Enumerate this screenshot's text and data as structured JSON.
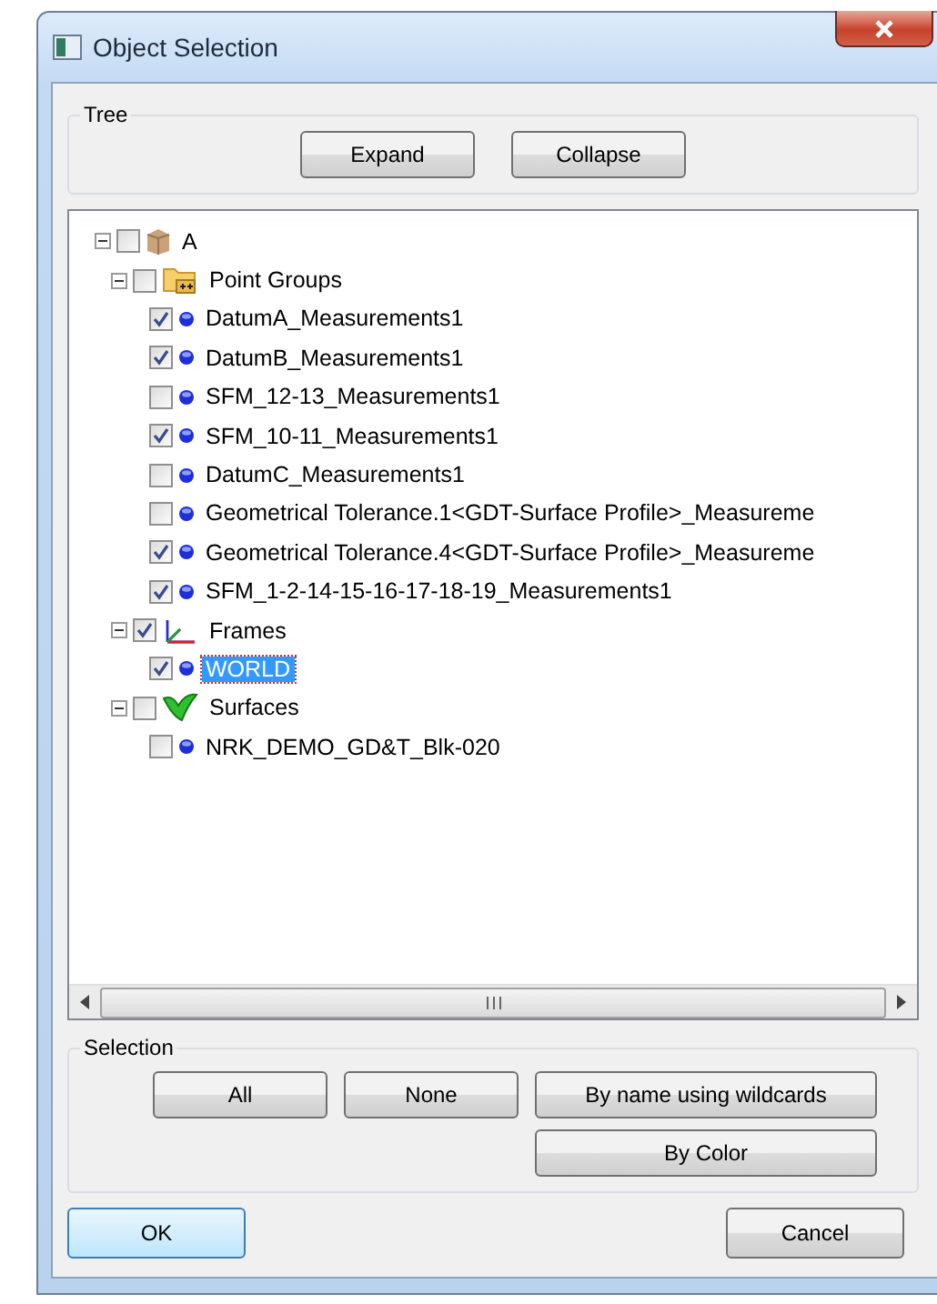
{
  "window": {
    "title": "Object Selection"
  },
  "tree_group": {
    "title": "Tree",
    "buttons": [
      "Expand",
      "Collapse"
    ]
  },
  "tree": [
    {
      "label": "A",
      "kind": "box",
      "checked": false,
      "expanded": true,
      "selected": false,
      "children": [
        {
          "label": "Point Groups",
          "kind": "folder",
          "checked": false,
          "expanded": true,
          "selected": false,
          "children": [
            {
              "label": "DatumA_Measurements1",
              "kind": "point",
              "checked": true,
              "selected": false
            },
            {
              "label": "DatumB_Measurements1",
              "kind": "point",
              "checked": true,
              "selected": false
            },
            {
              "label": "SFM_12-13_Measurements1",
              "kind": "point",
              "checked": false,
              "selected": false
            },
            {
              "label": "SFM_10-11_Measurements1",
              "kind": "point",
              "checked": true,
              "selected": false
            },
            {
              "label": "DatumC_Measurements1",
              "kind": "point",
              "checked": false,
              "selected": false
            },
            {
              "label": "Geometrical Tolerance.1<GDT-Surface Profile>_Measureme",
              "kind": "point",
              "checked": false,
              "selected": false
            },
            {
              "label": "Geometrical Tolerance.4<GDT-Surface Profile>_Measureme",
              "kind": "point",
              "checked": true,
              "selected": false
            },
            {
              "label": "SFM_1-2-14-15-16-17-18-19_Measurements1",
              "kind": "point",
              "checked": true,
              "selected": false
            }
          ]
        },
        {
          "label": "Frames",
          "kind": "axes",
          "checked": true,
          "expanded": true,
          "selected": false,
          "children": [
            {
              "label": "WORLD",
              "kind": "point",
              "checked": true,
              "selected": true
            }
          ]
        },
        {
          "label": "Surfaces",
          "kind": "surface",
          "checked": false,
          "expanded": true,
          "selected": false,
          "children": [
            {
              "label": "NRK_DEMO_GD&T_Blk-020",
              "kind": "point",
              "checked": false,
              "selected": false
            }
          ]
        }
      ]
    }
  ],
  "selection_group": {
    "title": "Selection",
    "buttons": [
      "All",
      "None",
      "By name using wildcards",
      "By Color"
    ]
  },
  "buttons": [
    {
      "label": "OK",
      "default": true
    },
    {
      "label": "Cancel",
      "default": false
    }
  ]
}
